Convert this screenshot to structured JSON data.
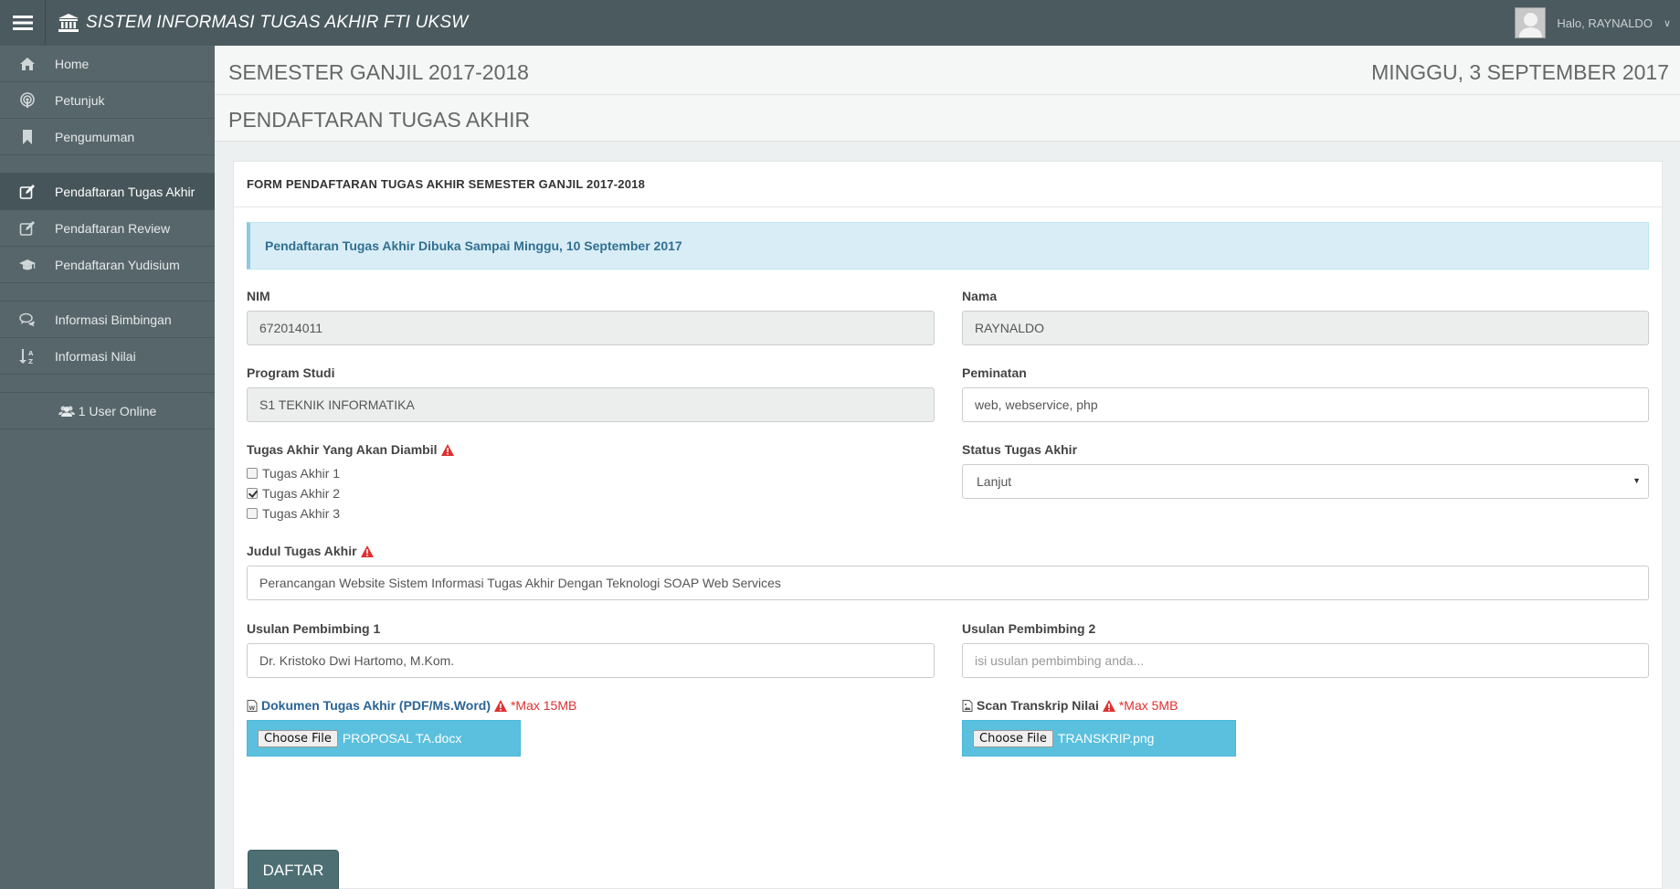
{
  "app": {
    "title": "SISTEM INFORMASI TUGAS AKHIR FTI UKSW",
    "user_greeting": "Halo, RAYNALDO"
  },
  "sidebar": {
    "items": [
      {
        "label": "Home",
        "icon": "home-icon"
      },
      {
        "label": "Petunjuk",
        "icon": "podcast-icon"
      },
      {
        "label": "Pengumuman",
        "icon": "bookmark-icon"
      },
      {
        "label": "Pendaftaran Tugas Akhir",
        "icon": "edit-icon",
        "active": true
      },
      {
        "label": "Pendaftaran Review",
        "icon": "edit-icon"
      },
      {
        "label": "Pendaftaran Yudisium",
        "icon": "graduation-cap-icon"
      },
      {
        "label": "Informasi Bimbingan",
        "icon": "comments-icon"
      },
      {
        "label": "Informasi Nilai",
        "icon": "sort-alpha-icon"
      }
    ],
    "online": "1 User Online"
  },
  "header": {
    "semester": "SEMESTER GANJIL 2017-2018",
    "date": "MINGGU, 3 SEPTEMBER 2017",
    "page_title": "PENDAFTARAN TUGAS AKHIR"
  },
  "form": {
    "heading": "FORM PENDAFTARAN TUGAS AKHIR SEMESTER GANJIL 2017-2018",
    "alert": "Pendaftaran Tugas Akhir Dibuka Sampai Minggu, 10 September 2017",
    "nim": {
      "label": "NIM",
      "value": "672014011"
    },
    "nama": {
      "label": "Nama",
      "value": "RAYNALDO"
    },
    "program_studi": {
      "label": "Program Studi",
      "value": "S1 TEKNIK INFORMATIKA"
    },
    "peminatan": {
      "label": "Peminatan",
      "value": "web, webservice, php"
    },
    "tugas_akhir": {
      "label": "Tugas Akhir Yang Akan Diambil",
      "options": [
        {
          "label": "Tugas Akhir 1",
          "checked": false
        },
        {
          "label": "Tugas Akhir 2",
          "checked": true
        },
        {
          "label": "Tugas Akhir 3",
          "checked": false
        }
      ]
    },
    "status": {
      "label": "Status Tugas Akhir",
      "value": "Lanjut"
    },
    "judul": {
      "label": "Judul Tugas Akhir",
      "value": "Perancangan Website Sistem Informasi Tugas Akhir Dengan Teknologi SOAP Web Services"
    },
    "pembimbing1": {
      "label": "Usulan Pembimbing 1",
      "value": "Dr. Kristoko Dwi Hartomo, M.Kom."
    },
    "pembimbing2": {
      "label": "Usulan Pembimbing 2",
      "placeholder": "isi usulan pembimbing anda..."
    },
    "dokumen": {
      "label": "Dokumen Tugas Akhir (PDF/Ms.Word)",
      "note": "*Max 15MB",
      "button": "Choose File",
      "file": "PROPOSAL TA.docx"
    },
    "transkrip": {
      "label": "Scan Transkrip Nilai",
      "note": "*Max 5MB",
      "button": "Choose File",
      "file": "TRANSKRIP.png"
    },
    "submit": "DAFTAR"
  },
  "colors": {
    "topbar": "#4b5a5f",
    "sidebar": "#57666b",
    "alert_bg": "#d9edf7",
    "file_bg": "#5bc0de",
    "submit_bg": "#4d6f73",
    "warning": "#e03030"
  }
}
